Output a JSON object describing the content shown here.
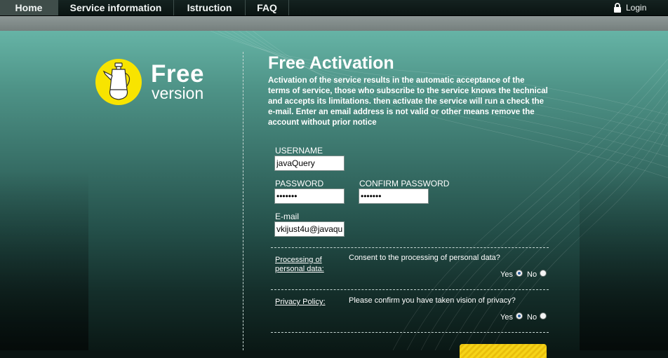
{
  "nav": {
    "items": [
      {
        "label": "Home",
        "active": true
      },
      {
        "label": "Service information",
        "active": false
      },
      {
        "label": "Istruction",
        "active": false
      },
      {
        "label": "FAQ",
        "active": false
      }
    ],
    "login_label": "Login",
    "login_icon": "lock-icon"
  },
  "logo": {
    "word1": "Free",
    "word2": "version",
    "icon": "teapot-icon",
    "accent_color": "#f8e400"
  },
  "activation": {
    "title": "Free Activation",
    "description": "Activation of the service results in the automatic acceptance of the terms of service, those who subscribe to the service knows the technical and accepts its limitations. then activate the service will run a check the e-mail. Enter an email address is not valid or other means remove the account without prior notice"
  },
  "form": {
    "username_label": "USERNAME",
    "username_value": "javaQuery",
    "password_label": "PASSWORD",
    "password_value": "•••••••",
    "confirm_label": "CONFIRM PASSWORD",
    "confirm_value": "•••••••",
    "email_label": "E-mail",
    "email_value": "vkijust4u@javaqu"
  },
  "consents": [
    {
      "link": "Processing of personal data:",
      "question": "Consent to the processing of personal data?",
      "yes_label": "Yes",
      "no_label": "No",
      "selected": "yes"
    },
    {
      "link": "Privacy Policy:",
      "question": "Please confirm you have taken vision of privacy?",
      "yes_label": "Yes",
      "no_label": "No",
      "selected": "yes"
    }
  ],
  "colors": {
    "background_top": "#66b4a6",
    "background_bottom": "#0a1815",
    "submit_button": "#f6d419"
  }
}
